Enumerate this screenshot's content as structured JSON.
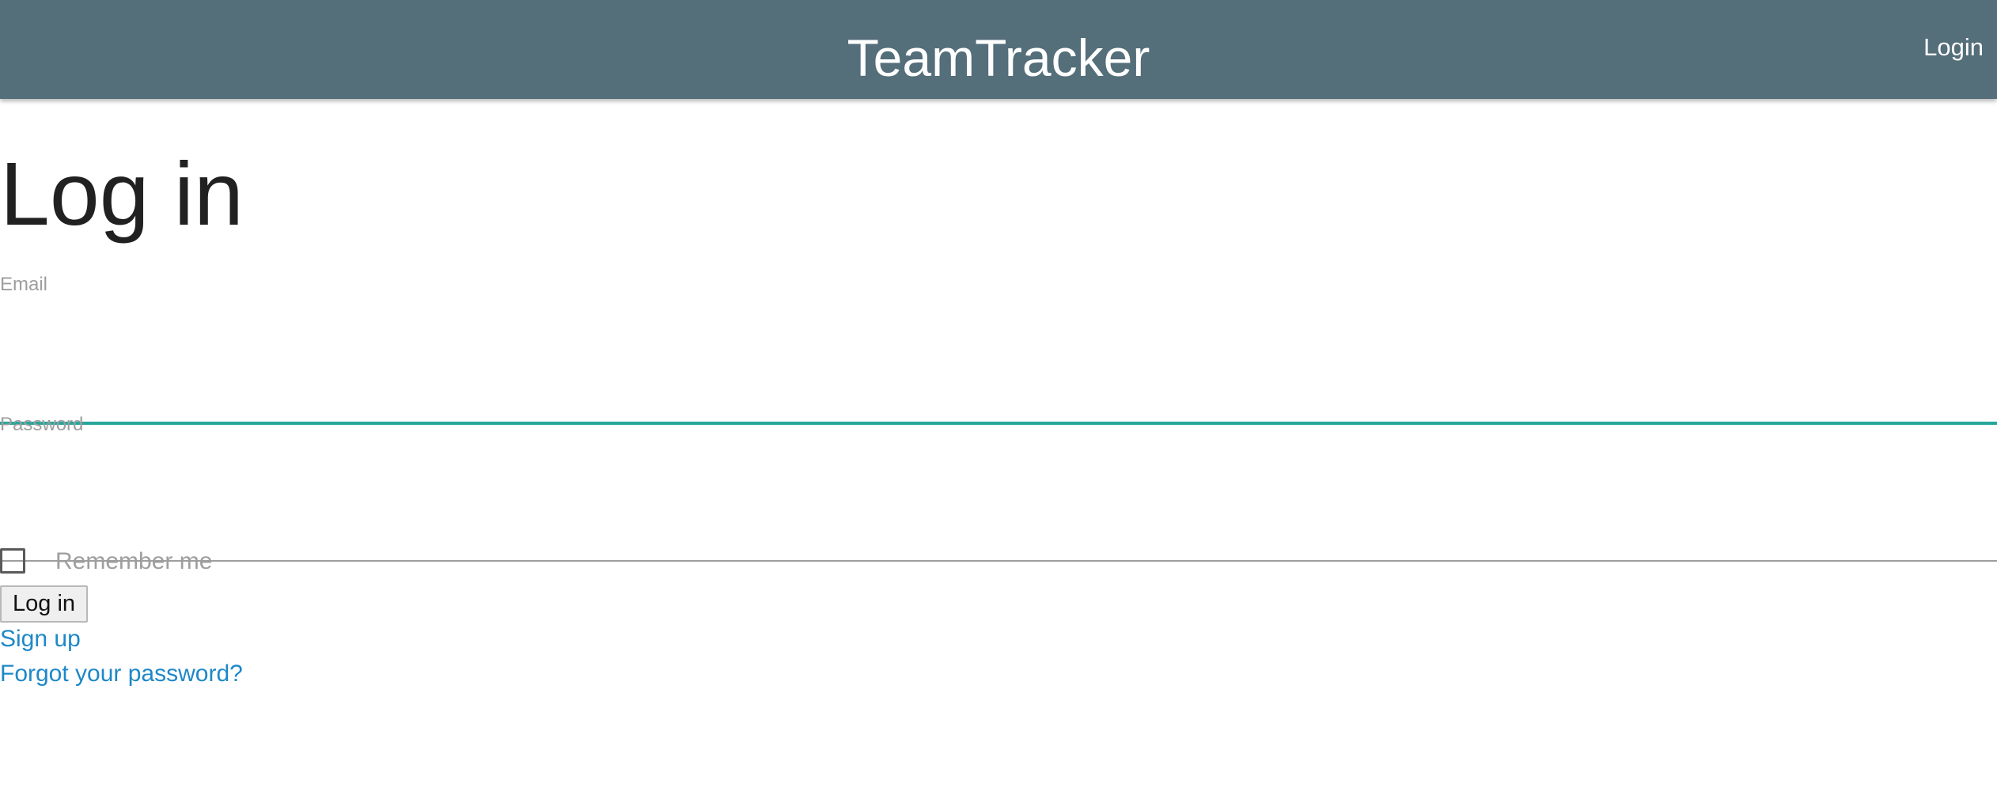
{
  "navbar": {
    "brand": "TeamTracker",
    "login_link": "Login"
  },
  "page": {
    "title": "Log in"
  },
  "form": {
    "email": {
      "label": "Email",
      "value": "",
      "placeholder": ""
    },
    "password": {
      "label": "Password",
      "value": "",
      "placeholder": ""
    },
    "remember_me": {
      "label": "Remember me",
      "checked": false
    },
    "submit_label": "Log in"
  },
  "links": {
    "sign_up": "Sign up",
    "forgot_password": "Forgot your password?"
  },
  "colors": {
    "navbar_background": "#546e7a",
    "focused_input_underline": "#26a69a",
    "link": "#1e88c8",
    "label": "#9e9e9e"
  }
}
